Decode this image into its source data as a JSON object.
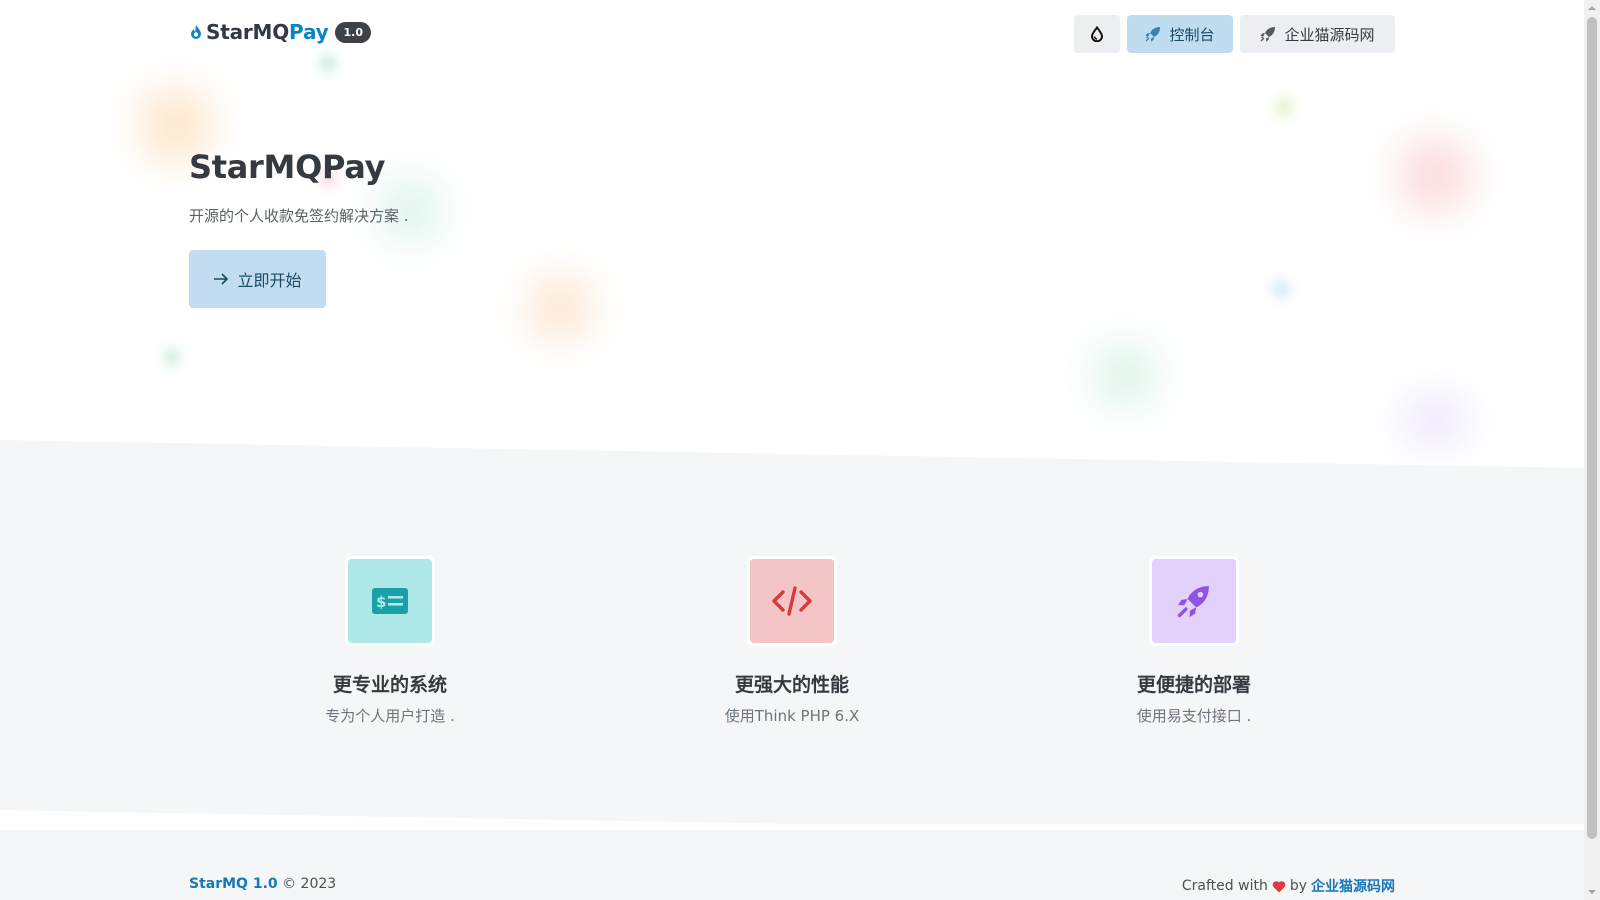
{
  "header": {
    "brand_prefix": "StarMQ",
    "brand_accent": "Pay",
    "version": "1.0",
    "nav": {
      "theme_icon": "droplet-icon",
      "console_label": "控制台",
      "site_label": "企业猫源码网"
    }
  },
  "hero": {
    "title": "StarMQPay",
    "subtitle": "开源的个人收款免签约解决方案 .",
    "cta_label": "立即开始"
  },
  "features": [
    {
      "icon": "money-bill-icon",
      "title": "更专业的系统",
      "desc": "专为个人用户打造 .",
      "bg": "#aee8e8",
      "fg": "#1aa1a7"
    },
    {
      "icon": "code-icon",
      "title": "更强大的性能",
      "desc": "使用Think PHP 6.X",
      "bg": "#f4c5c7",
      "fg": "#d8393f"
    },
    {
      "icon": "rocket-icon",
      "title": "更便捷的部署",
      "desc": "使用易支付接口 .",
      "bg": "#e1d1fb",
      "fg": "#8d54e0"
    }
  ],
  "footer": {
    "brand": "StarMQ 1.0",
    "copyright": "© 2023",
    "crafted": "Crafted with",
    "by": "by",
    "author": "企业猫源码网"
  },
  "colors": {
    "accent": "#0a84c9",
    "cta_bg": "#c2ddf1",
    "band_bg": "#f5f6f8"
  }
}
